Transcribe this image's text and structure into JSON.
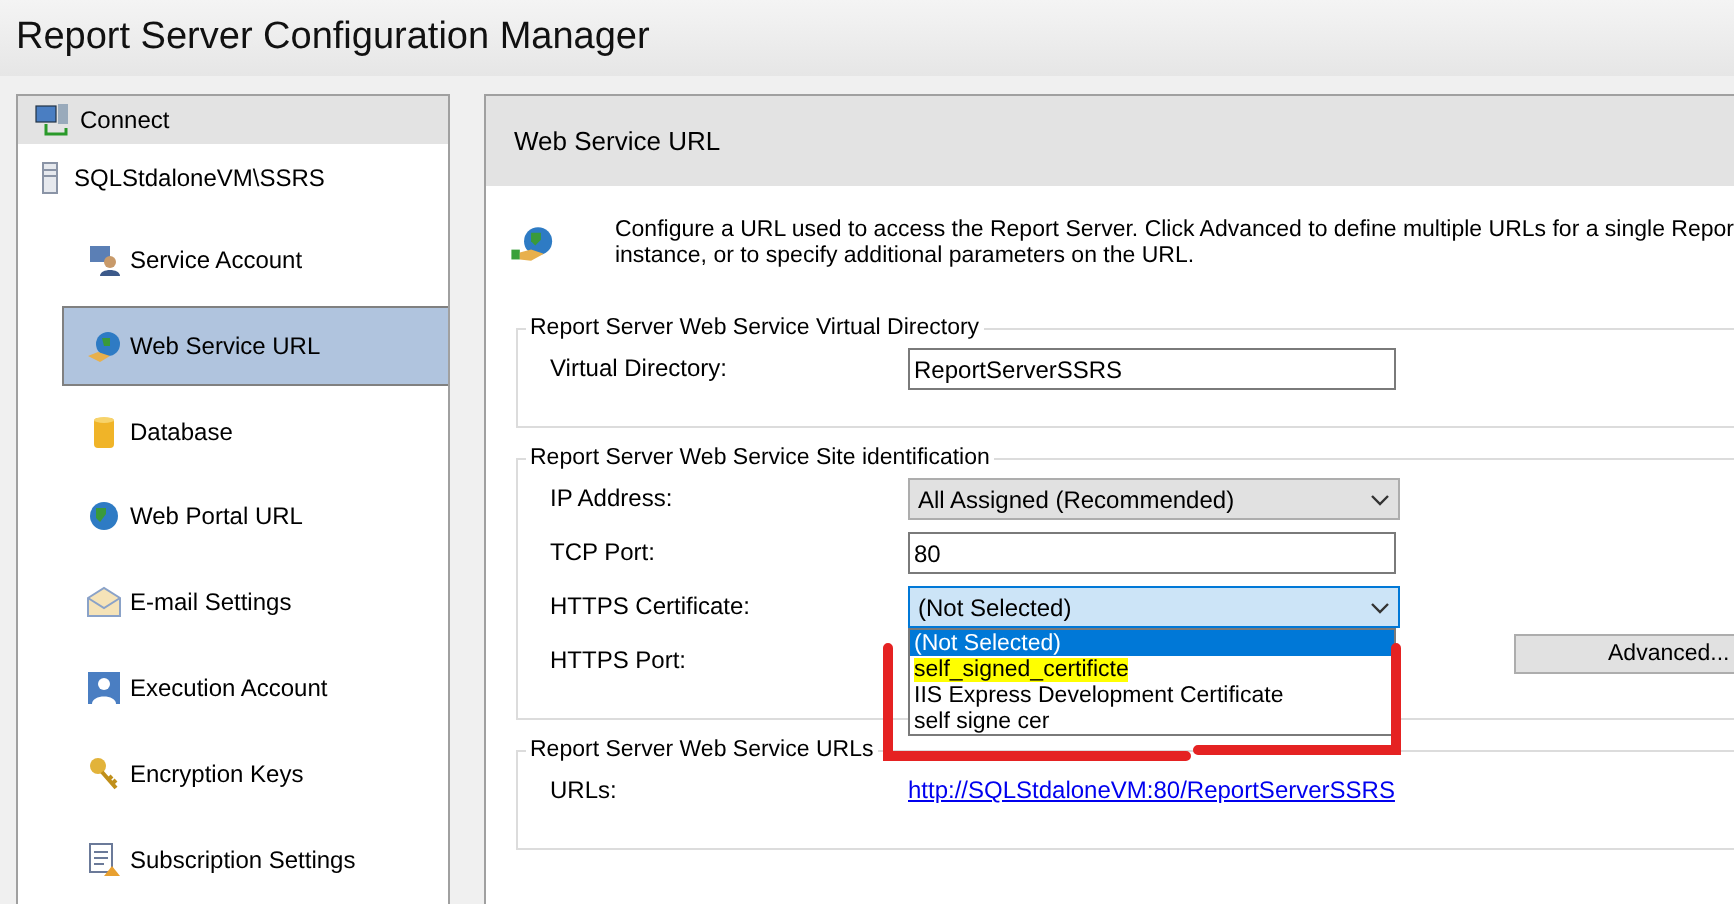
{
  "window": {
    "title": "Report Server Configuration Manager"
  },
  "sidebar": {
    "connect": "Connect",
    "server": "SQLStdaloneVM\\SSRS",
    "items": [
      {
        "label": "Service Account",
        "kind": "account",
        "selected": false
      },
      {
        "label": "Web Service URL",
        "kind": "webservice",
        "selected": true
      },
      {
        "label": "Database",
        "kind": "database",
        "selected": false
      },
      {
        "label": "Web Portal URL",
        "kind": "globe",
        "selected": false
      },
      {
        "label": "E-mail Settings",
        "kind": "email",
        "selected": false
      },
      {
        "label": "Execution Account",
        "kind": "person",
        "selected": false
      },
      {
        "label": "Encryption Keys",
        "kind": "keys",
        "selected": false
      },
      {
        "label": "Subscription Settings",
        "kind": "document",
        "selected": false
      }
    ]
  },
  "main": {
    "header": "Web Service URL",
    "description": "Configure a URL used to access the Report Server.  Click Advanced to define multiple URLs for a single Repor",
    "description_line2": "instance, or to specify additional parameters on the URL.",
    "groups": [
      {
        "title": "Report Server Web Service Virtual Directory",
        "fields": [
          {
            "kind": "text",
            "label": "Virtual Directory:",
            "value": "ReportServerSSRS"
          }
        ]
      },
      {
        "title": "Report Server Web Service Site identification",
        "button": "Advanced...",
        "fields": [
          {
            "kind": "select",
            "label": "IP Address:",
            "value": "All Assigned (Recommended)",
            "expanded": false
          },
          {
            "kind": "text",
            "label": "TCP Port:",
            "value": "80"
          },
          {
            "kind": "select",
            "label": "HTTPS Certificate:",
            "value": "(Not Selected)",
            "expanded": true,
            "options": [
              {
                "label": "(Not Selected)",
                "selected": true,
                "highlighted": false
              },
              {
                "label": "self_signed_certificte",
                "selected": false,
                "highlighted": true
              },
              {
                "label": "IIS Express Development Certificate",
                "selected": false,
                "highlighted": false
              },
              {
                "label": "self signe cer",
                "selected": false,
                "highlighted": false
              }
            ]
          },
          {
            "kind": "covered",
            "label": "HTTPS Port:"
          }
        ]
      },
      {
        "title": "Report Server Web Service URLs",
        "fields": [
          {
            "kind": "link",
            "label": "URLs:",
            "value": "http://SQLStdaloneVM:80/ReportServerSSRS"
          }
        ]
      }
    ]
  }
}
